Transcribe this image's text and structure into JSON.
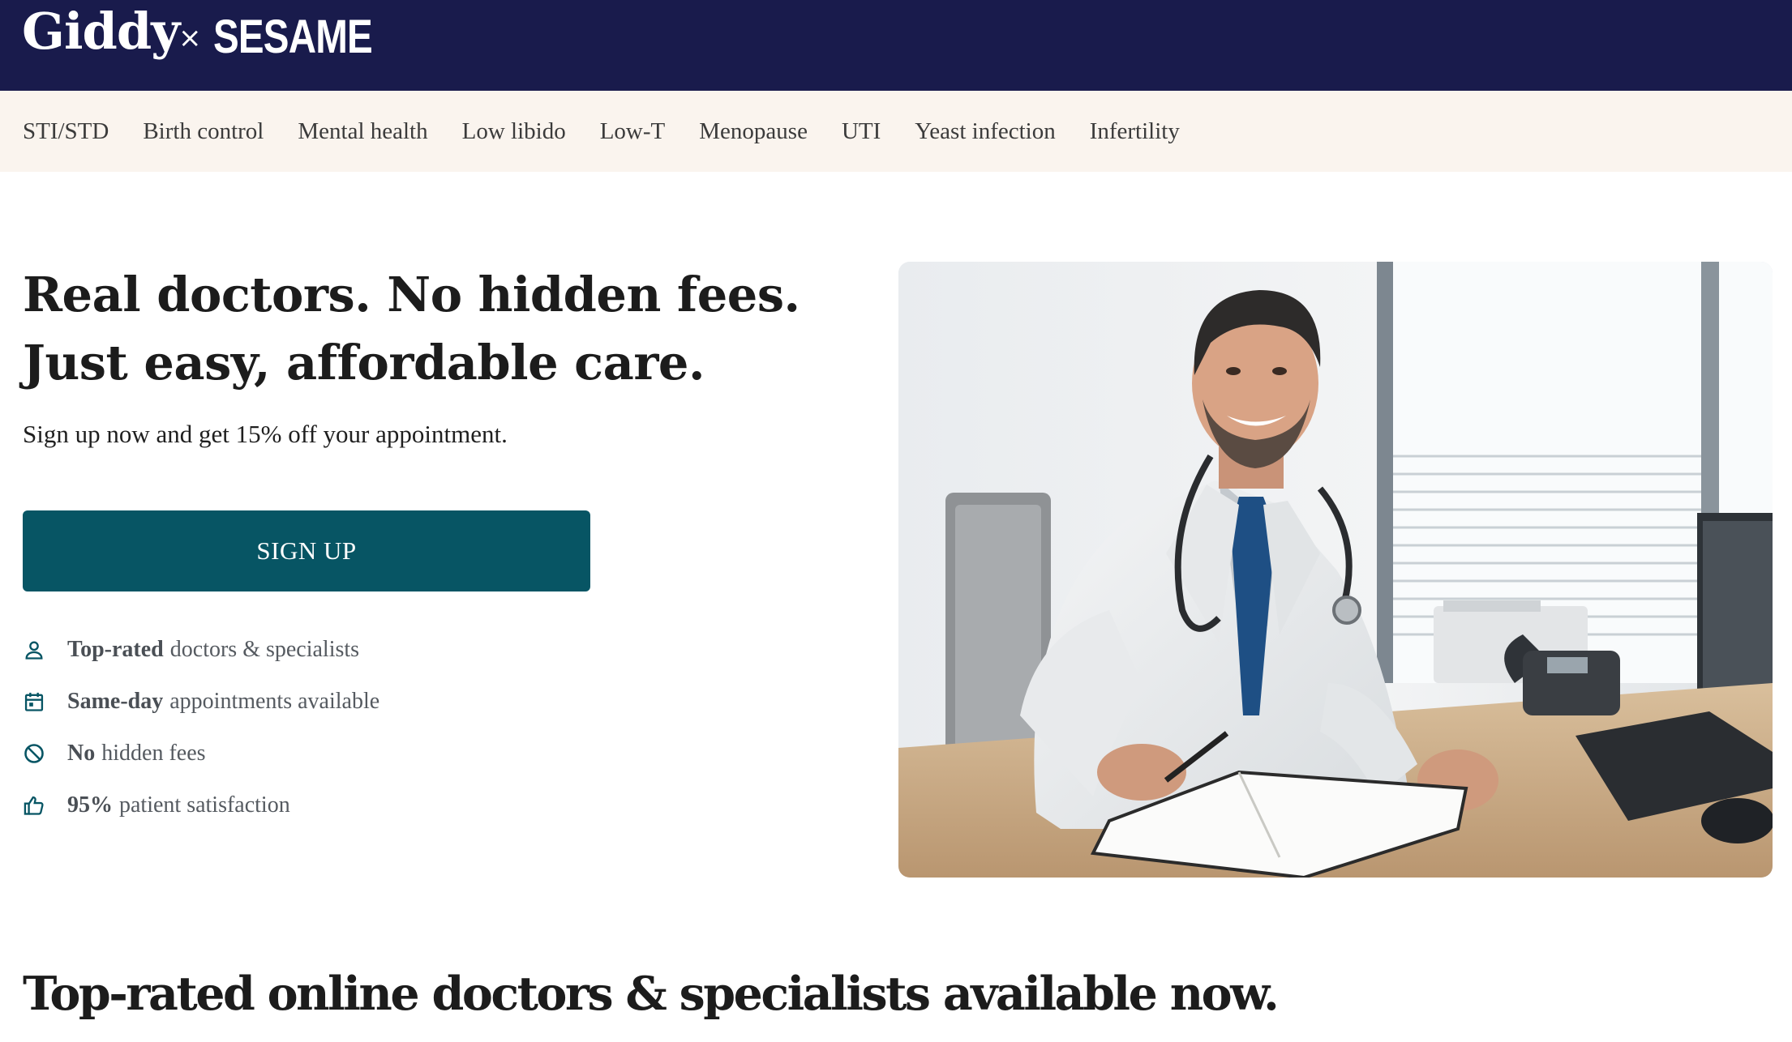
{
  "brand": {
    "primary": "Giddy",
    "separator": "×",
    "partner": "SESAME",
    "bar_color": "#191b4c"
  },
  "nav": {
    "items": [
      "STI/STD",
      "Birth control",
      "Mental health",
      "Low libido",
      "Low-T",
      "Menopause",
      "UTI",
      "Yeast infection",
      "Infertility"
    ],
    "background": "#faf4ee"
  },
  "hero": {
    "title_line1": "Real doctors. No hidden fees.",
    "title_line2": "Just easy, affordable care.",
    "subtitle": "Sign up now and get 15% off your appointment.",
    "cta_label": "SIGN UP",
    "cta_color": "#075564",
    "image_subject": "smiling doctor in white coat with stethoscope at desk"
  },
  "features": [
    {
      "icon": "person-icon",
      "bold": "Top-rated",
      "text": "doctors & specialists"
    },
    {
      "icon": "calendar-icon",
      "bold": "Same-day",
      "text": "appointments available"
    },
    {
      "icon": "no-entry-icon",
      "bold": "No",
      "text": "hidden fees"
    },
    {
      "icon": "thumbs-up-icon",
      "bold": "95%",
      "text": "patient satisfaction"
    }
  ],
  "section": {
    "title": "Top-rated online doctors & specialists available now."
  }
}
